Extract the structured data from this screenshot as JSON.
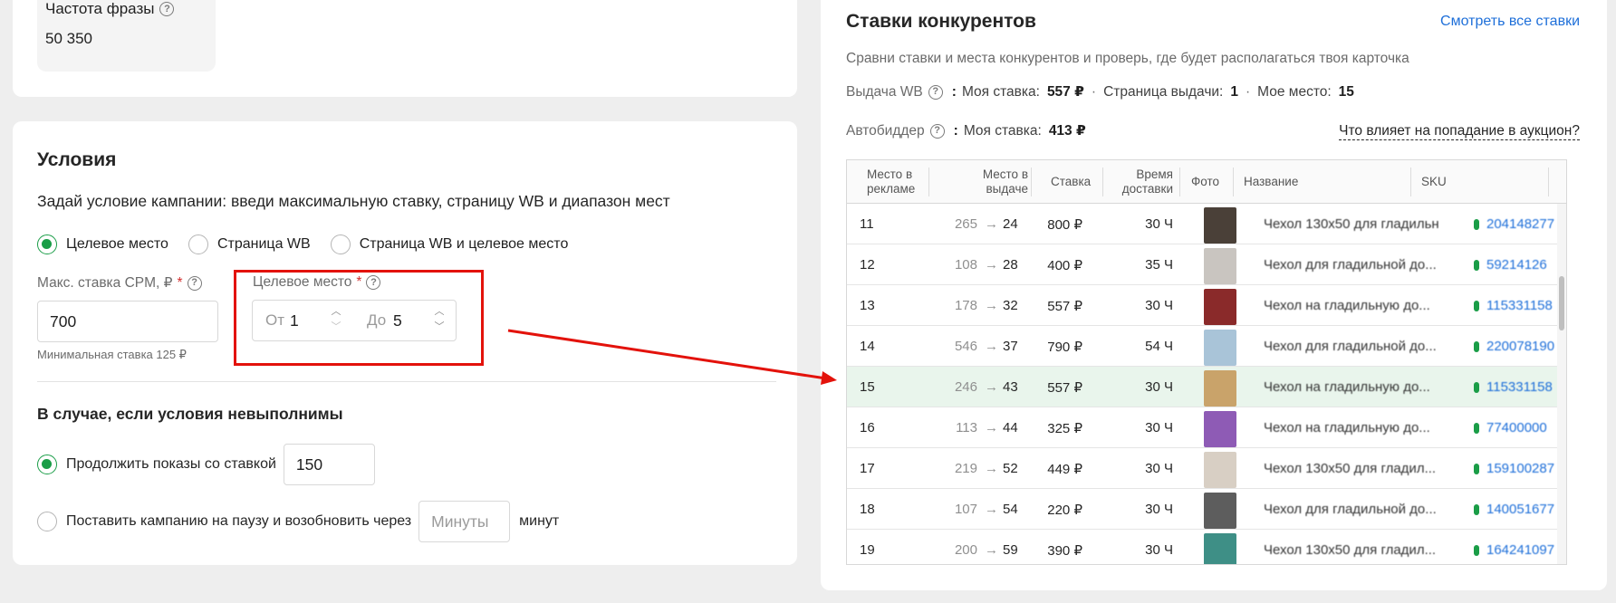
{
  "freq": {
    "title": "Частота фразы",
    "value": "50 350"
  },
  "conditions": {
    "title": "Условия",
    "description": "Задай условие кампании: введи максимальную ставку, страницу WB и диапазон мест",
    "modes": [
      {
        "label": "Целевое место",
        "selected": true
      },
      {
        "label": "Страница WB",
        "selected": false
      },
      {
        "label": "Страница WB и целевое место",
        "selected": false
      }
    ],
    "max_bid": {
      "label": "Макс. ставка CPM, ₽",
      "value": "700",
      "hint": "Минимальная ставка 125 ₽"
    },
    "target": {
      "label": "Целевое место",
      "from_prefix": "От",
      "from_value": "1",
      "to_prefix": "До",
      "to_value": "5"
    },
    "fallback": {
      "title": "В случае, если условия невыполнимы",
      "continue_label": "Продолжить показы со ставкой",
      "continue_value": "150",
      "pause_label": "Поставить кампанию на паузу и возобновить через",
      "pause_placeholder": "Минуты",
      "pause_suffix": "минут"
    }
  },
  "competitors": {
    "title": "Ставки конкурентов",
    "see_all": "Смотреть все ставки",
    "description": "Сравни ставки и места конкурентов и проверь, где будет располагаться твоя карточка",
    "wb": {
      "label": "Выдача WB",
      "bid_label": "Моя ставка:",
      "bid_value": "557 ₽",
      "page_label": "Страница выдачи:",
      "page_value": "1",
      "place_label": "Мое место:",
      "place_value": "15"
    },
    "auto": {
      "label": "Автобиддер",
      "bid_label": "Моя ставка:",
      "bid_value": "413 ₽"
    },
    "auction_link": "Что влияет на попадание в аукцион?",
    "columns": {
      "ad_place": "Место в рекламе",
      "serp_place": "Место в выдаче",
      "bid": "Ставка",
      "delivery": "Время доставки",
      "photo": "Фото",
      "name": "Название",
      "sku": "SKU"
    },
    "rows": [
      {
        "ad": "11",
        "from": "265",
        "to": "24",
        "bid": "800 ₽",
        "time": "30 Ч",
        "name": "Чехол 130x50 для гладильн",
        "sku": "204148277",
        "photo": "#4a4038"
      },
      {
        "ad": "12",
        "from": "108",
        "to": "28",
        "bid": "400 ₽",
        "time": "35 Ч",
        "name": "Чехол для гладильной до...",
        "sku": "59214126",
        "photo": "#c9c5c0"
      },
      {
        "ad": "13",
        "from": "178",
        "to": "32",
        "bid": "557 ₽",
        "time": "30 Ч",
        "name": "Чехол на гладильную до...",
        "sku": "115331158",
        "photo": "#8a2a2a"
      },
      {
        "ad": "14",
        "from": "546",
        "to": "37",
        "bid": "790 ₽",
        "time": "54 Ч",
        "name": "Чехол для гладильной до...",
        "sku": "220078190",
        "photo": "#a9c4d8"
      },
      {
        "ad": "15",
        "from": "246",
        "to": "43",
        "bid": "557 ₽",
        "time": "30 Ч",
        "name": "Чехол на гладильную до...",
        "sku": "115331158",
        "photo": "#c9a36a",
        "selected": true
      },
      {
        "ad": "16",
        "from": "113",
        "to": "44",
        "bid": "325 ₽",
        "time": "30 Ч",
        "name": "Чехол на гладильную до...",
        "sku": "77400000",
        "photo": "#8e5bb5"
      },
      {
        "ad": "17",
        "from": "219",
        "to": "52",
        "bid": "449 ₽",
        "time": "30 Ч",
        "name": "Чехол 130x50 для гладил...",
        "sku": "159100287",
        "photo": "#d8cfc4"
      },
      {
        "ad": "18",
        "from": "107",
        "to": "54",
        "bid": "220 ₽",
        "time": "30 Ч",
        "name": "Чехол для гладильной до...",
        "sku": "140051677",
        "photo": "#5d5d5d"
      },
      {
        "ad": "19",
        "from": "200",
        "to": "59",
        "bid": "390 ₽",
        "time": "30 Ч",
        "name": "Чехол 130x50 для гладил...",
        "sku": "164241097",
        "photo": "#3e8f86"
      }
    ]
  },
  "colors": {
    "accent_green": "#1a9d47",
    "link_blue": "#1e6fd9",
    "highlight_red": "#e3120b",
    "row_selected": "#e9f5ec"
  }
}
